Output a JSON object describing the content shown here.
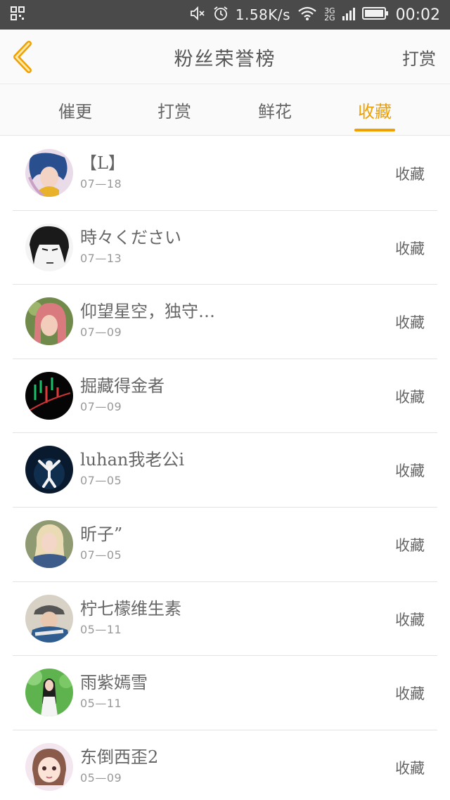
{
  "status_bar": {
    "speed": "1.58K/s",
    "net_top": "3G",
    "net_bottom": "2G",
    "time": "00:02",
    "icons": [
      "qr-scan-icon",
      "mute-icon",
      "alarm-icon",
      "wifi-icon",
      "signal-icon",
      "battery-icon"
    ]
  },
  "header": {
    "title": "粉丝荣誉榜",
    "action_label": "打赏",
    "back_icon": "chevron-left-icon",
    "accent_color": "#f0a000"
  },
  "tabs": [
    {
      "label": "催更",
      "active": false
    },
    {
      "label": "打赏",
      "active": false
    },
    {
      "label": "鲜花",
      "active": false
    },
    {
      "label": "收藏",
      "active": true
    }
  ],
  "list": [
    {
      "name": "【L】",
      "date": "07—18",
      "action": "收藏",
      "avatar": "avatar-anime-blue-hair"
    },
    {
      "name": "時々ください",
      "date": "07—13",
      "action": "收藏",
      "avatar": "avatar-sketch-face"
    },
    {
      "name": "仰望星空，独守…",
      "date": "07—09",
      "action": "收藏",
      "avatar": "avatar-girl-pink-hair"
    },
    {
      "name": "掘藏得金者",
      "date": "07—09",
      "action": "收藏",
      "avatar": "avatar-stock-chart"
    },
    {
      "name": "luhan我老公i",
      "date": "07—05",
      "action": "收藏",
      "avatar": "avatar-stage-performer"
    },
    {
      "name": "昕子”",
      "date": "07—05",
      "action": "收藏",
      "avatar": "avatar-blonde-girl"
    },
    {
      "name": "柠七檬维生素",
      "date": "05—11",
      "action": "收藏",
      "avatar": "avatar-boy-cap"
    },
    {
      "name": "雨紫嫣雪",
      "date": "05—11",
      "action": "收藏",
      "avatar": "avatar-girl-green"
    },
    {
      "name": "东倒西歪2",
      "date": "05—09",
      "action": "收藏",
      "avatar": "avatar-anime-girl-sketch"
    }
  ]
}
